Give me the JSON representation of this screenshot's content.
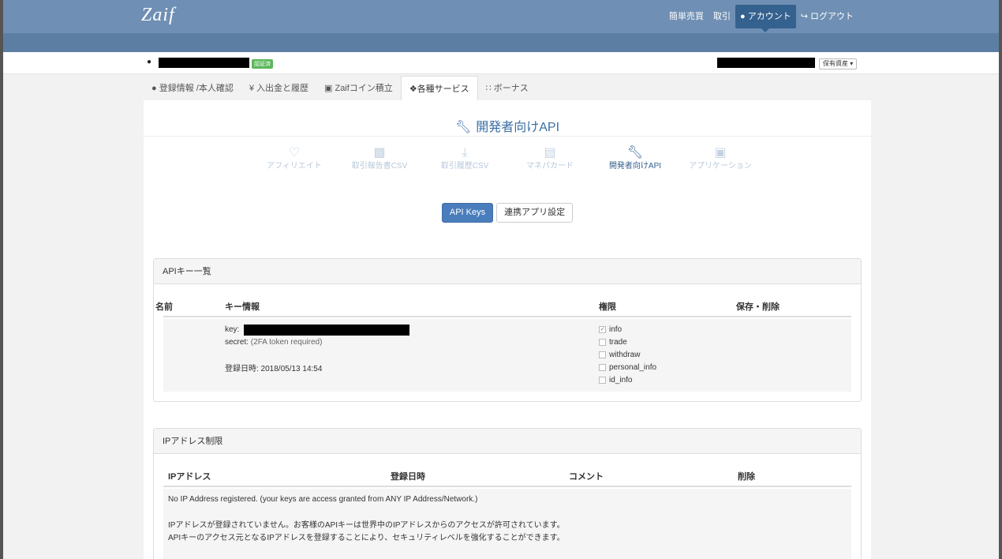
{
  "header": {
    "logo": "Zaif",
    "nav": [
      "簡単売買",
      "取引",
      "アカウント",
      "ログアウト"
    ]
  },
  "userbar": {
    "badge": "認証済",
    "assets_label": "保有資産 ▾"
  },
  "tabs": [
    {
      "label": "登録情報 /本人確認",
      "icon": "user-icon"
    },
    {
      "label": "入出金と履歴",
      "icon": "yen-icon"
    },
    {
      "label": "Zaifコイン積立",
      "icon": "savings-icon"
    },
    {
      "label": "各種サービス",
      "icon": "tags-icon"
    },
    {
      "label": "ボーナス",
      "icon": "grid-icon"
    }
  ],
  "page": {
    "title": "開発者向けAPI"
  },
  "services": [
    {
      "label": "アフィリエイト",
      "icon": "heart-icon"
    },
    {
      "label": "取引報告書CSV",
      "icon": "file-icon"
    },
    {
      "label": "取引履歴CSV",
      "icon": "download-icon"
    },
    {
      "label": "マネパカード",
      "icon": "card-icon"
    },
    {
      "label": "開発者向けAPI",
      "icon": "wrench-icon"
    },
    {
      "label": "アプリケーション",
      "icon": "briefcase-icon"
    }
  ],
  "buttons": {
    "api_keys": "API Keys",
    "linked_apps": "連携アプリ設定"
  },
  "api_panel": {
    "title": "APIキー一覧",
    "columns": [
      "名前",
      "キー情報",
      "権限",
      "保存・削除"
    ],
    "key_label": "key:",
    "secret_label": "secret:",
    "secret_value": "(2FA token required)",
    "registered": "登録日時: 2018/05/13 14:54",
    "permissions": [
      {
        "name": "info",
        "checked": true
      },
      {
        "name": "trade",
        "checked": false
      },
      {
        "name": "withdraw",
        "checked": false
      },
      {
        "name": "personal_info",
        "checked": false
      },
      {
        "name": "id_info",
        "checked": false
      }
    ]
  },
  "ip_panel": {
    "title": "IPアドレス制限",
    "columns": [
      "IPアドレス",
      "登録日時",
      "コメント",
      "削除"
    ],
    "empty_en": "No IP Address registered. (your keys are access granted from ANY IP Address/Network.)",
    "empty_ja_1": "IPアドレスが登録されていません。お客様のAPIキーは世界中のIPアドレスからのアクセスが許可されています。",
    "empty_ja_2": "APIキーのアクセス元となるIPアドレスを登録することにより、セキュリティレベルを強化することができます。"
  }
}
